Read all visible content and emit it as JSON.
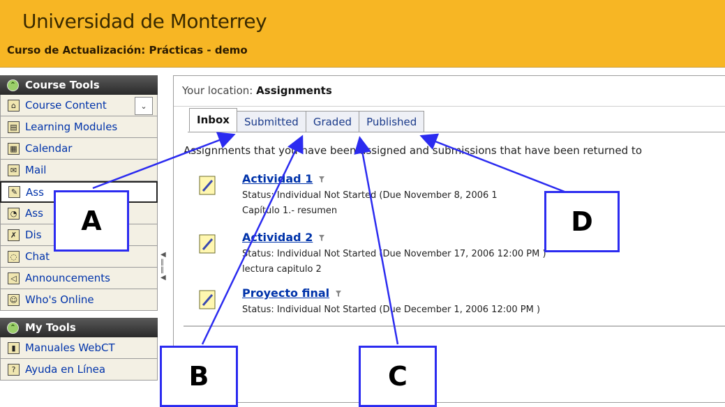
{
  "header": {
    "university": "Universidad de Monterrey",
    "course": "Curso de Actualización: Prácticas - demo",
    "background": "#f7b624"
  },
  "sidebar": {
    "course_tools": {
      "title": "Course Tools",
      "items": [
        {
          "label": "Course Content",
          "icon": "home-icon"
        },
        {
          "label": "Learning Modules",
          "icon": "modules-icon"
        },
        {
          "label": "Calendar",
          "icon": "calendar-icon"
        },
        {
          "label": "Mail",
          "icon": "mail-icon"
        },
        {
          "label": "Ass",
          "icon": "assignments-icon"
        },
        {
          "label": "Ass",
          "icon": "assessments-icon"
        },
        {
          "label": "Dis",
          "icon": "discussions-icon"
        },
        {
          "label": "Chat",
          "icon": "chat-icon"
        },
        {
          "label": "Announcements",
          "icon": "megaphone-icon"
        },
        {
          "label": "Who's Online",
          "icon": "people-icon"
        }
      ]
    },
    "my_tools": {
      "title": "My Tools",
      "items": [
        {
          "label": "Manuales WebCT",
          "icon": "book-icon"
        },
        {
          "label": "Ayuda en Línea",
          "icon": "help-icon"
        }
      ]
    }
  },
  "main": {
    "location_label": "Your location:",
    "location_value": "Assignments",
    "tabs": [
      {
        "label": "Inbox",
        "active": true
      },
      {
        "label": "Submitted",
        "active": false
      },
      {
        "label": "Graded",
        "active": false
      },
      {
        "label": "Published",
        "active": false
      }
    ],
    "intro": "Assignments that you have been assigned and submissions that have been returned to",
    "assignments": [
      {
        "title": "Actividad 1",
        "status": "Status: Individual Not Started (Due November 8, 2006 1",
        "description": "Capítulo 1.- resumen"
      },
      {
        "title": "Actividad 2",
        "status": "Status: Individual Not Started (Due November 17, 2006 12:00 PM )",
        "description": "lectura capitulo 2"
      },
      {
        "title": "Proyecto final",
        "status": "Status: Individual Not Started (Due December 1, 2006 12:00 PM )",
        "description": ""
      }
    ]
  },
  "callouts": {
    "a": "A",
    "b": "B",
    "c": "C",
    "d": "D",
    "color": "#2b2bf0"
  }
}
